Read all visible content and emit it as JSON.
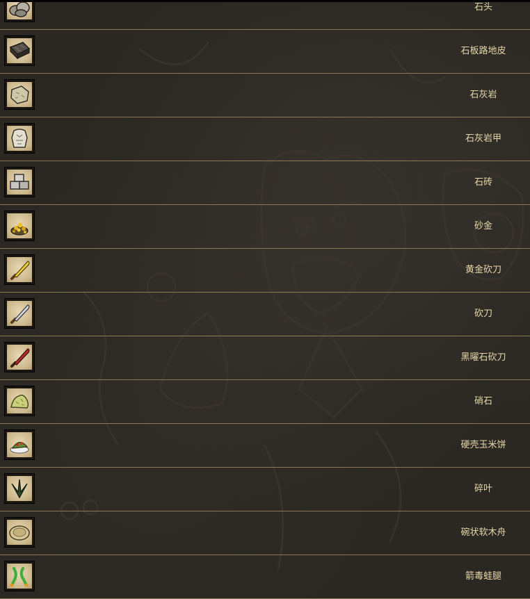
{
  "items": [
    {
      "name": "石头",
      "icon": "rocks-icon"
    },
    {
      "name": "石板路地皮",
      "icon": "cobblestone-turf-icon"
    },
    {
      "name": "石灰岩",
      "icon": "limestone-icon"
    },
    {
      "name": "石灰岩甲",
      "icon": "limestone-suit-icon"
    },
    {
      "name": "石砖",
      "icon": "cut-stone-icon"
    },
    {
      "name": "砂金",
      "icon": "gold-dust-icon"
    },
    {
      "name": "黄金砍刀",
      "icon": "luxury-machete-icon"
    },
    {
      "name": "砍刀",
      "icon": "machete-icon"
    },
    {
      "name": "黑曜石砍刀",
      "icon": "obsidian-machete-icon"
    },
    {
      "name": "硝石",
      "icon": "nitre-icon"
    },
    {
      "name": "硬壳玉米饼",
      "icon": "hard-shell-tacos-icon"
    },
    {
      "name": "碎叶",
      "icon": "foliage-icon"
    },
    {
      "name": "碗状软木舟",
      "icon": "corkboat-icon"
    },
    {
      "name": "箭毒蛙腿",
      "icon": "poison-dartfrog-legs-icon"
    }
  ],
  "colors": {
    "label_text": "#e6d8a8",
    "row_divider": "#8a7a55",
    "background": "#2b2824",
    "icon_parchment": "#d8c59c"
  }
}
